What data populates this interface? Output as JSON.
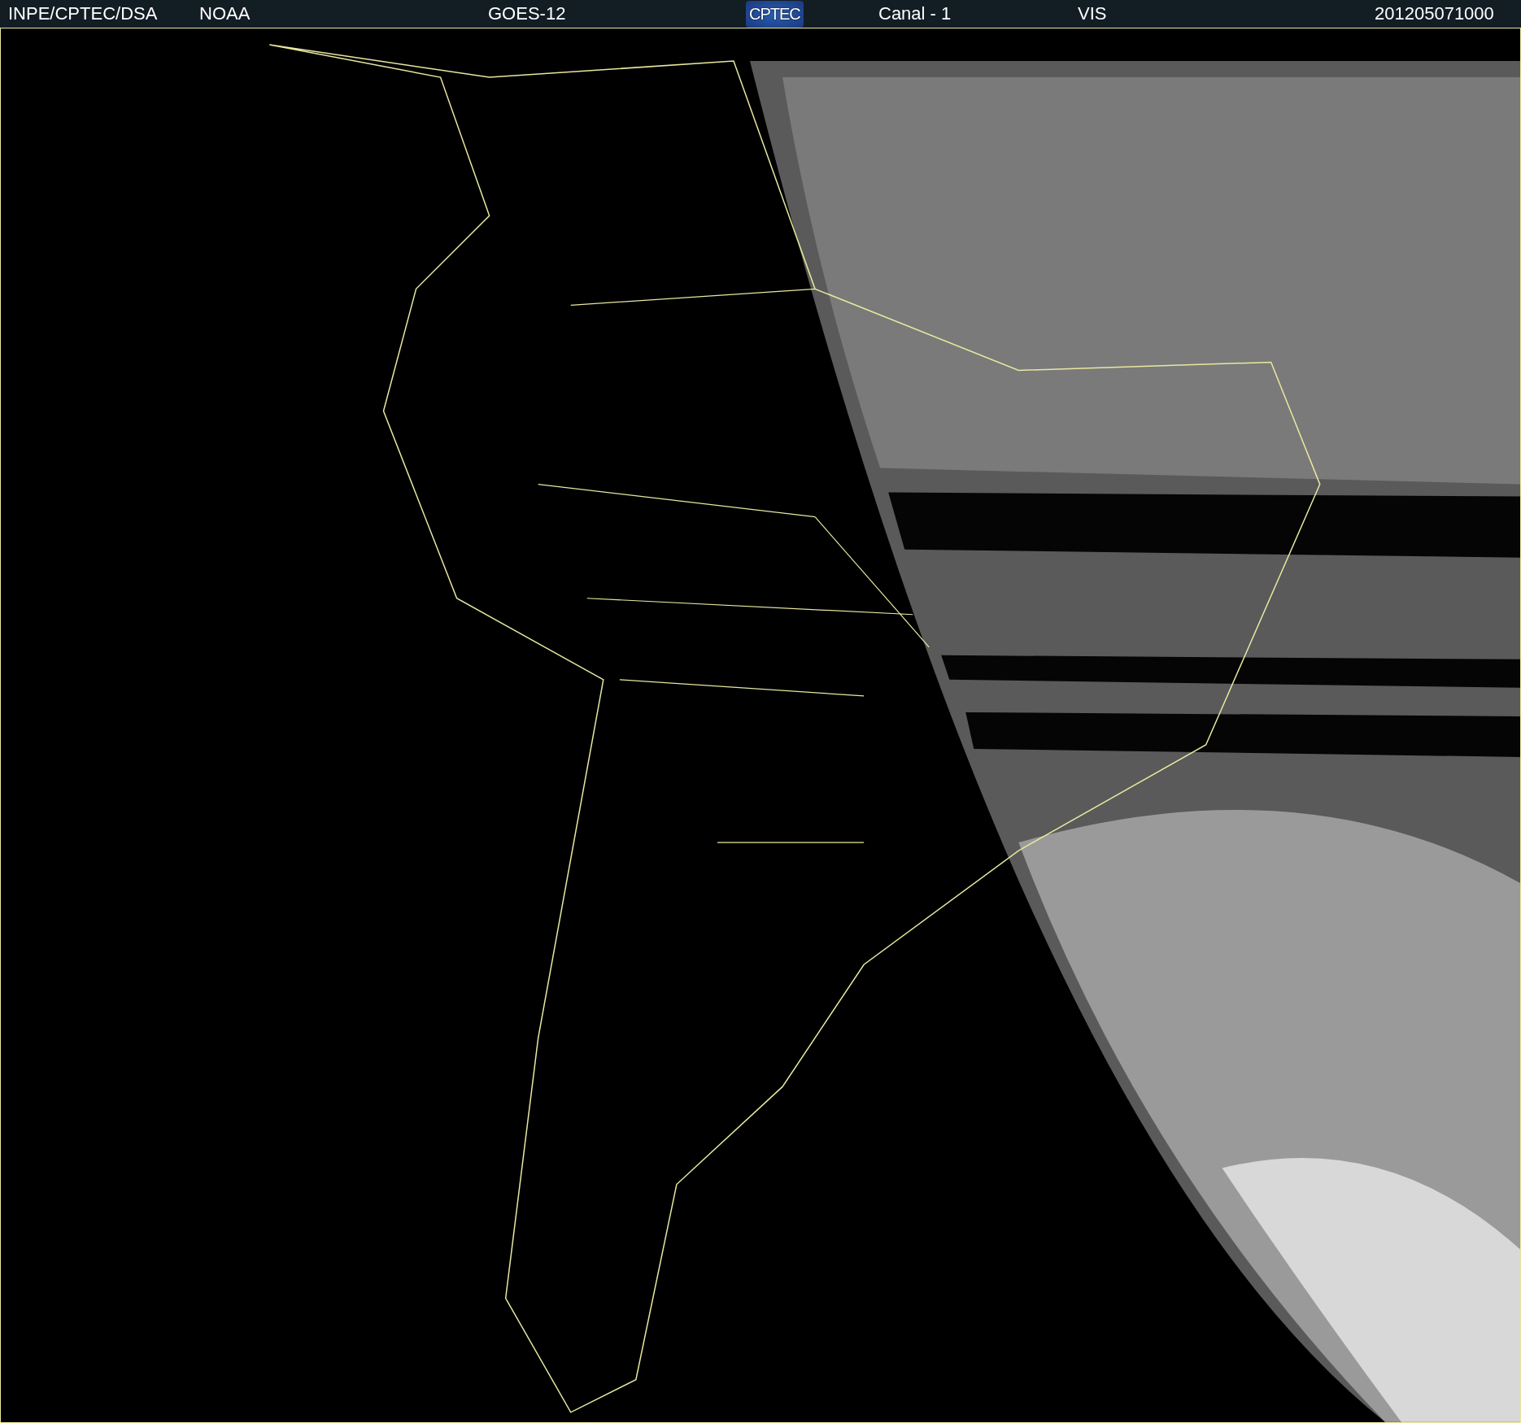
{
  "header": {
    "source": "INPE/CPTEC/DSA",
    "agency": "NOAA",
    "satellite": "GOES-12",
    "logo": "CPTEC",
    "channel": "Canal - 1",
    "band": "VIS",
    "timestamp": "201205071000"
  }
}
